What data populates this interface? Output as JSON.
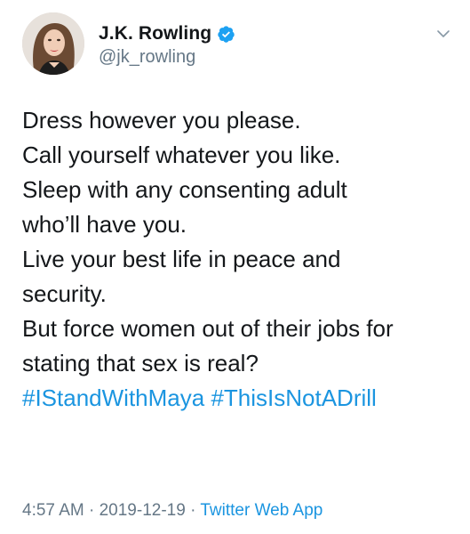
{
  "user": {
    "display_name": "J.K. Rowling",
    "handle": "@jk_rowling",
    "verified": true
  },
  "tweet": {
    "lines": [
      "Dress however you please.",
      "Call yourself whatever you like.",
      "Sleep with any consenting adult",
      "who’ll have you.",
      "Live your best life in peace and",
      "security.",
      "But force women out of their jobs for",
      "stating that sex is real?"
    ],
    "hashtags": [
      "#IStandWithMaya",
      "#ThisIsNotADrill"
    ]
  },
  "meta": {
    "time": "4:57 AM",
    "separator": " · ",
    "date": "2019-12-19",
    "source": "Twitter Web App"
  },
  "icons": {
    "verified": "verified-badge-icon",
    "menu": "chevron-down-icon"
  },
  "colors": {
    "link": "#1b95e0",
    "secondary_text": "#657786",
    "primary_text": "#14171a"
  }
}
